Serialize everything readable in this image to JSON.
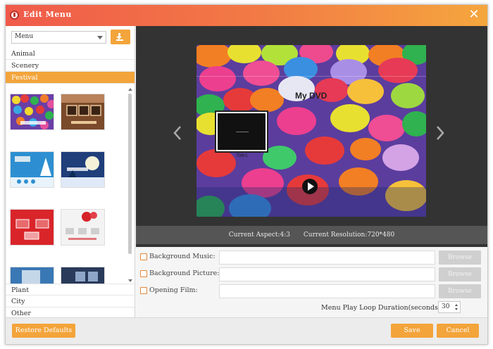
{
  "window": {
    "title": "Edit Menu"
  },
  "template_panel": {
    "select_value": "Menu",
    "categories_top": [
      "Animal",
      "Scenery",
      "Festival"
    ],
    "active_category": "Festival",
    "categories_bottom": [
      "Plant",
      "City",
      "Other"
    ]
  },
  "preview": {
    "menu_title": "My DVD",
    "title_label": "Title1",
    "aspect_label": "Current Aspect:4:3",
    "resolution_label": "Current Resolution:720*480"
  },
  "options": {
    "background_music_label": "Background Music:",
    "background_picture_label": "Background Picture:",
    "opening_film_label": "Opening Film:",
    "browse_label": "Browse",
    "loop_duration_label": "Menu Play Loop Duration(seconds):",
    "loop_duration_value": "30"
  },
  "footer": {
    "restore_label": "Restore Defaults",
    "save_label": "Save",
    "cancel_label": "Cancel"
  },
  "colors": {
    "accent": "#f3a43b",
    "title_gradient_start": "#f05a4a",
    "preview_bg": "#333333"
  }
}
